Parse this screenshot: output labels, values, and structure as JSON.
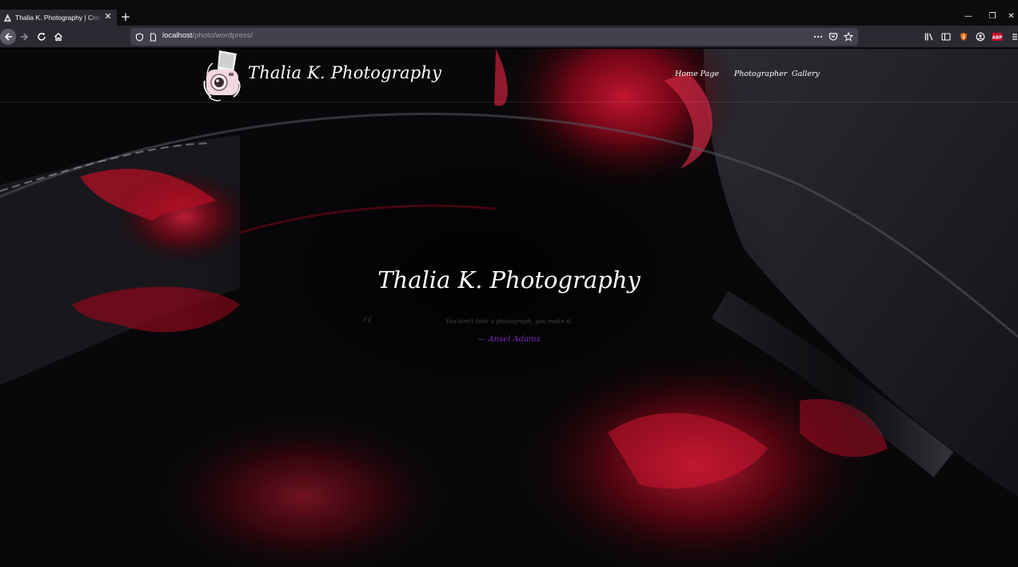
{
  "browser": {
    "tab": {
      "title": "Thalia K. Photography | Create"
    },
    "url": {
      "host": "localhost",
      "path": "/photo/wordpress/"
    },
    "extension_badge": "ABP"
  },
  "site": {
    "title": "Thalia K. Photography",
    "menu": [
      "Home Page",
      "Photographer",
      "Gallery"
    ],
    "hero": {
      "title": "Thalia K. Photography",
      "quote": "You don't take a photograph, you make it.",
      "author": "— Ansel Adams"
    }
  },
  "icons": {
    "back": "arrow-left-icon",
    "forward": "arrow-right-icon",
    "reload": "reload-icon",
    "home": "home-icon",
    "shield": "shield-icon",
    "page": "page-icon",
    "more": "more-dots-icon",
    "pocket": "pocket-icon",
    "bookmark": "star-icon",
    "library": "library-icon",
    "sidebar": "sidebar-icon",
    "account": "account-icon",
    "menu": "hamburger-icon"
  },
  "colors": {
    "chrome_dark": "#0c0c0d",
    "chrome_toolbar": "#2b2a33",
    "urlbar": "#42414d",
    "accent_purple": "#7a2fb4",
    "bg_red": "#c8102e"
  }
}
